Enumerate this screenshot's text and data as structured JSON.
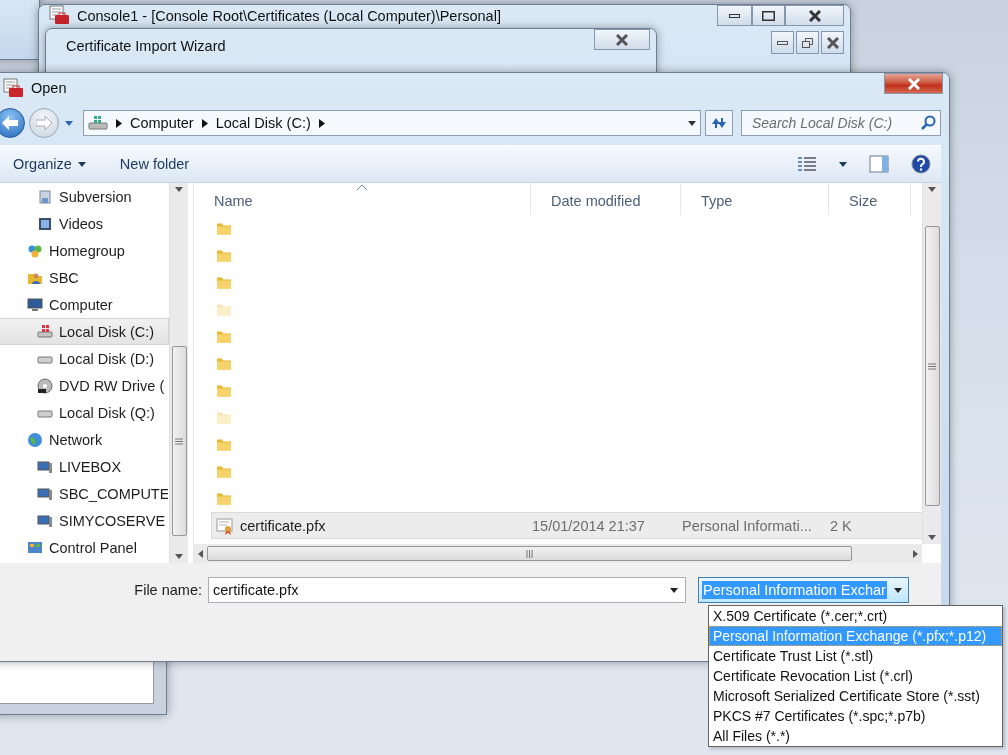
{
  "console_window": {
    "title": "Console1 - [Console Root\\Certificates (Local Computer)\\Personal]"
  },
  "wizard_window": {
    "title": "Certificate Import Wizard"
  },
  "dialog": {
    "title": "Open",
    "address": [
      "Computer",
      "Local Disk (C:)"
    ],
    "search": {
      "placeholder": "Search Local Disk (C:)"
    },
    "toolbar": [
      {
        "label": "Organize",
        "kind": "menu"
      },
      {
        "label": "New folder",
        "kind": "plain"
      }
    ],
    "nav_tree": [
      {
        "children": [
          {
            "label": "Subversion",
            "kind": "library",
            "selected": false
          },
          {
            "label": "Videos",
            "kind": "video",
            "selected": false
          }
        ]
      },
      {
        "label": "Homegroup",
        "kind": "homegroup",
        "selected": false
      },
      {
        "label": "SBC",
        "kind": "user",
        "selected": false
      },
      {
        "label": "Computer",
        "kind": "computer",
        "selected": false,
        "children": [
          {
            "label": "Local Disk (C:)",
            "kind": "system",
            "selected": true
          },
          {
            "label": "Local Disk (D:)",
            "kind": "disk",
            "selected": false
          },
          {
            "label": "DVD RW Drive (",
            "kind": "dvd",
            "selected": false
          },
          {
            "label": "Local Disk (Q:)",
            "kind": "disk",
            "selected": false
          }
        ]
      },
      {
        "label": "Network",
        "kind": "network",
        "selected": false,
        "children": [
          {
            "label": "LIVEBOX",
            "kind": "pc",
            "selected": false
          },
          {
            "label": "SBC_COMPUTE",
            "kind": "pc",
            "selected": false
          },
          {
            "label": "SIMYCOSERVE",
            "kind": "pc",
            "selected": false
          }
        ]
      },
      {
        "label": "Control Panel",
        "kind": "panel",
        "selected": false
      }
    ],
    "columns": [
      {
        "label": "Name",
        "sorted": true
      },
      {
        "label": "Date modified",
        "sorted": false
      },
      {
        "label": "Type",
        "sorted": false
      },
      {
        "label": "Size",
        "sorted": false
      }
    ],
    "files": [
      {
        "kind": "folder",
        "hidden": false,
        "selected": false
      },
      {
        "kind": "folder",
        "hidden": false,
        "selected": false
      },
      {
        "kind": "folder",
        "hidden": false,
        "selected": false
      },
      {
        "kind": "folder",
        "hidden": true,
        "selected": false
      },
      {
        "kind": "folder",
        "hidden": false,
        "selected": false
      },
      {
        "kind": "folder",
        "hidden": false,
        "selected": false
      },
      {
        "kind": "folder",
        "hidden": false,
        "selected": false
      },
      {
        "kind": "folder",
        "hidden": true,
        "selected": false
      },
      {
        "kind": "folder",
        "hidden": false,
        "selected": false
      },
      {
        "kind": "folder",
        "hidden": false,
        "selected": false
      },
      {
        "kind": "folder",
        "hidden": false,
        "selected": false
      },
      {
        "kind": "file",
        "name": "certificate.pfx",
        "date": "15/01/2014 21:37",
        "type": "Personal Informati...",
        "size": "2 K",
        "selected": true
      }
    ],
    "file_name": {
      "label": "File name:",
      "value": "certificate.pfx"
    },
    "filter": {
      "value": "Personal Information Exchar",
      "expanded": true,
      "options": [
        {
          "label": "X.509 Certificate (*.cer;*.crt)",
          "selected": false
        },
        {
          "label": "Personal Information Exchange (*.pfx;*.p12)",
          "selected": true
        },
        {
          "label": "Certificate Trust List (*.stl)",
          "selected": false
        },
        {
          "label": "Certificate Revocation List (*.crl)",
          "selected": false
        },
        {
          "label": "Microsoft Serialized Certificate Store (*.sst)",
          "selected": false
        },
        {
          "label": "PKCS #7 Certificates (*.spc;*.p7b)",
          "selected": false
        },
        {
          "label": "All Files (*.*)",
          "selected": false
        }
      ]
    }
  }
}
